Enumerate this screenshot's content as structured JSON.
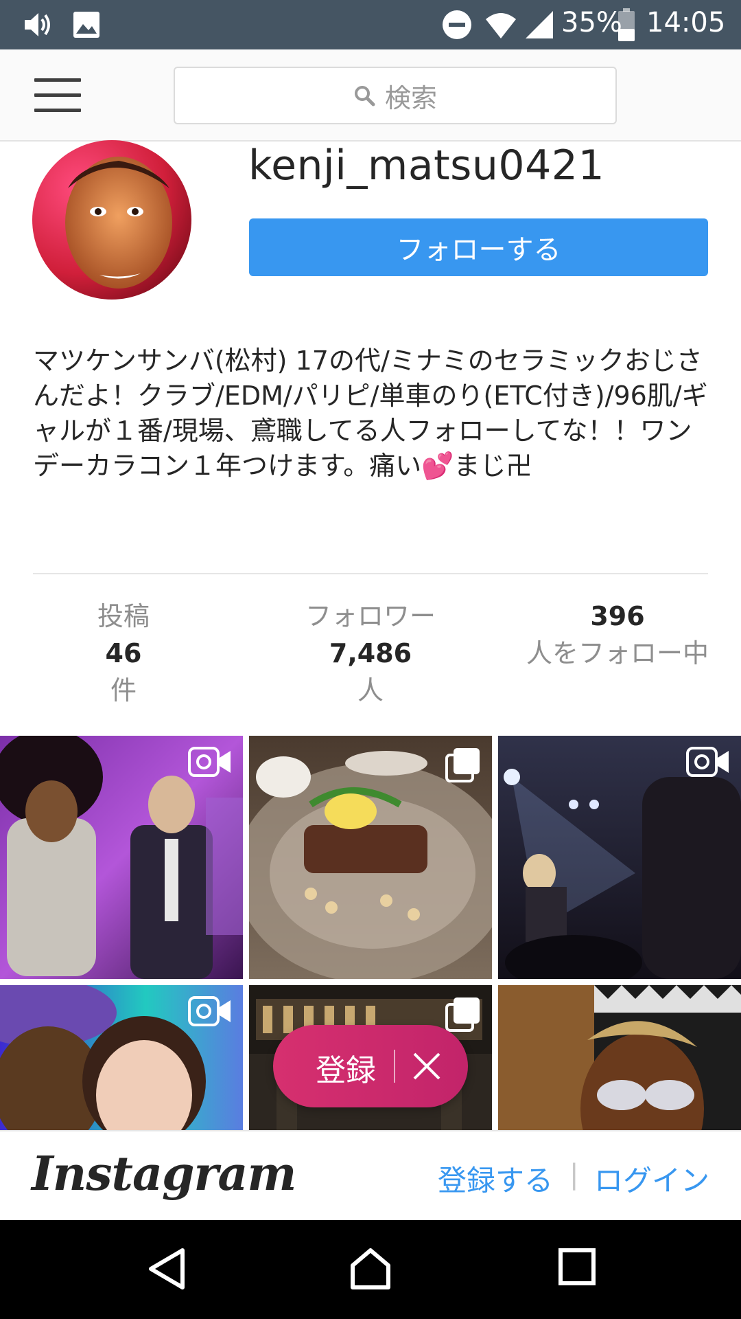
{
  "status_bar": {
    "battery": "35%",
    "time": "14:05",
    "icons": [
      "volume-icon",
      "image-icon",
      "do-not-disturb-icon",
      "wifi-icon",
      "signal-icon",
      "battery-icon"
    ]
  },
  "topnav": {
    "menu_icon": "hamburger-icon",
    "search_placeholder": "検索"
  },
  "profile": {
    "username": "kenji_matsu0421",
    "follow_label": "フォローする",
    "bio_part1": "マツケンサンバ(松村) 17の代/ミナミのセラミックおじさんだよ！クラブ/EDM/パリピ/単車のり(ETC付き)/96肌/ギャルが１番/現場、鳶職してる人フォローしてな！！ワンデーカラコン１年つけます。痛い",
    "bio_emoji": "💕",
    "bio_part2": "まじ卍"
  },
  "stats": {
    "posts": {
      "label": "投稿",
      "value": "46",
      "unit": "件"
    },
    "followers": {
      "label": "フォロワー",
      "value": "7,486",
      "unit": "人"
    },
    "following": {
      "value": "396",
      "label": "人をフォロー中"
    }
  },
  "grid": {
    "tiles": [
      {
        "type": "video"
      },
      {
        "type": "album"
      },
      {
        "type": "video"
      },
      {
        "type": "video"
      },
      {
        "type": "album"
      },
      {
        "type": "photo"
      }
    ]
  },
  "register_pill": {
    "label": "登録"
  },
  "bottom_banner": {
    "logo": "Instagram",
    "signup": "登録する",
    "separator": "|",
    "login": "ログイン"
  },
  "android_nav": {
    "icons": [
      "back-icon",
      "home-icon",
      "recents-icon"
    ]
  }
}
